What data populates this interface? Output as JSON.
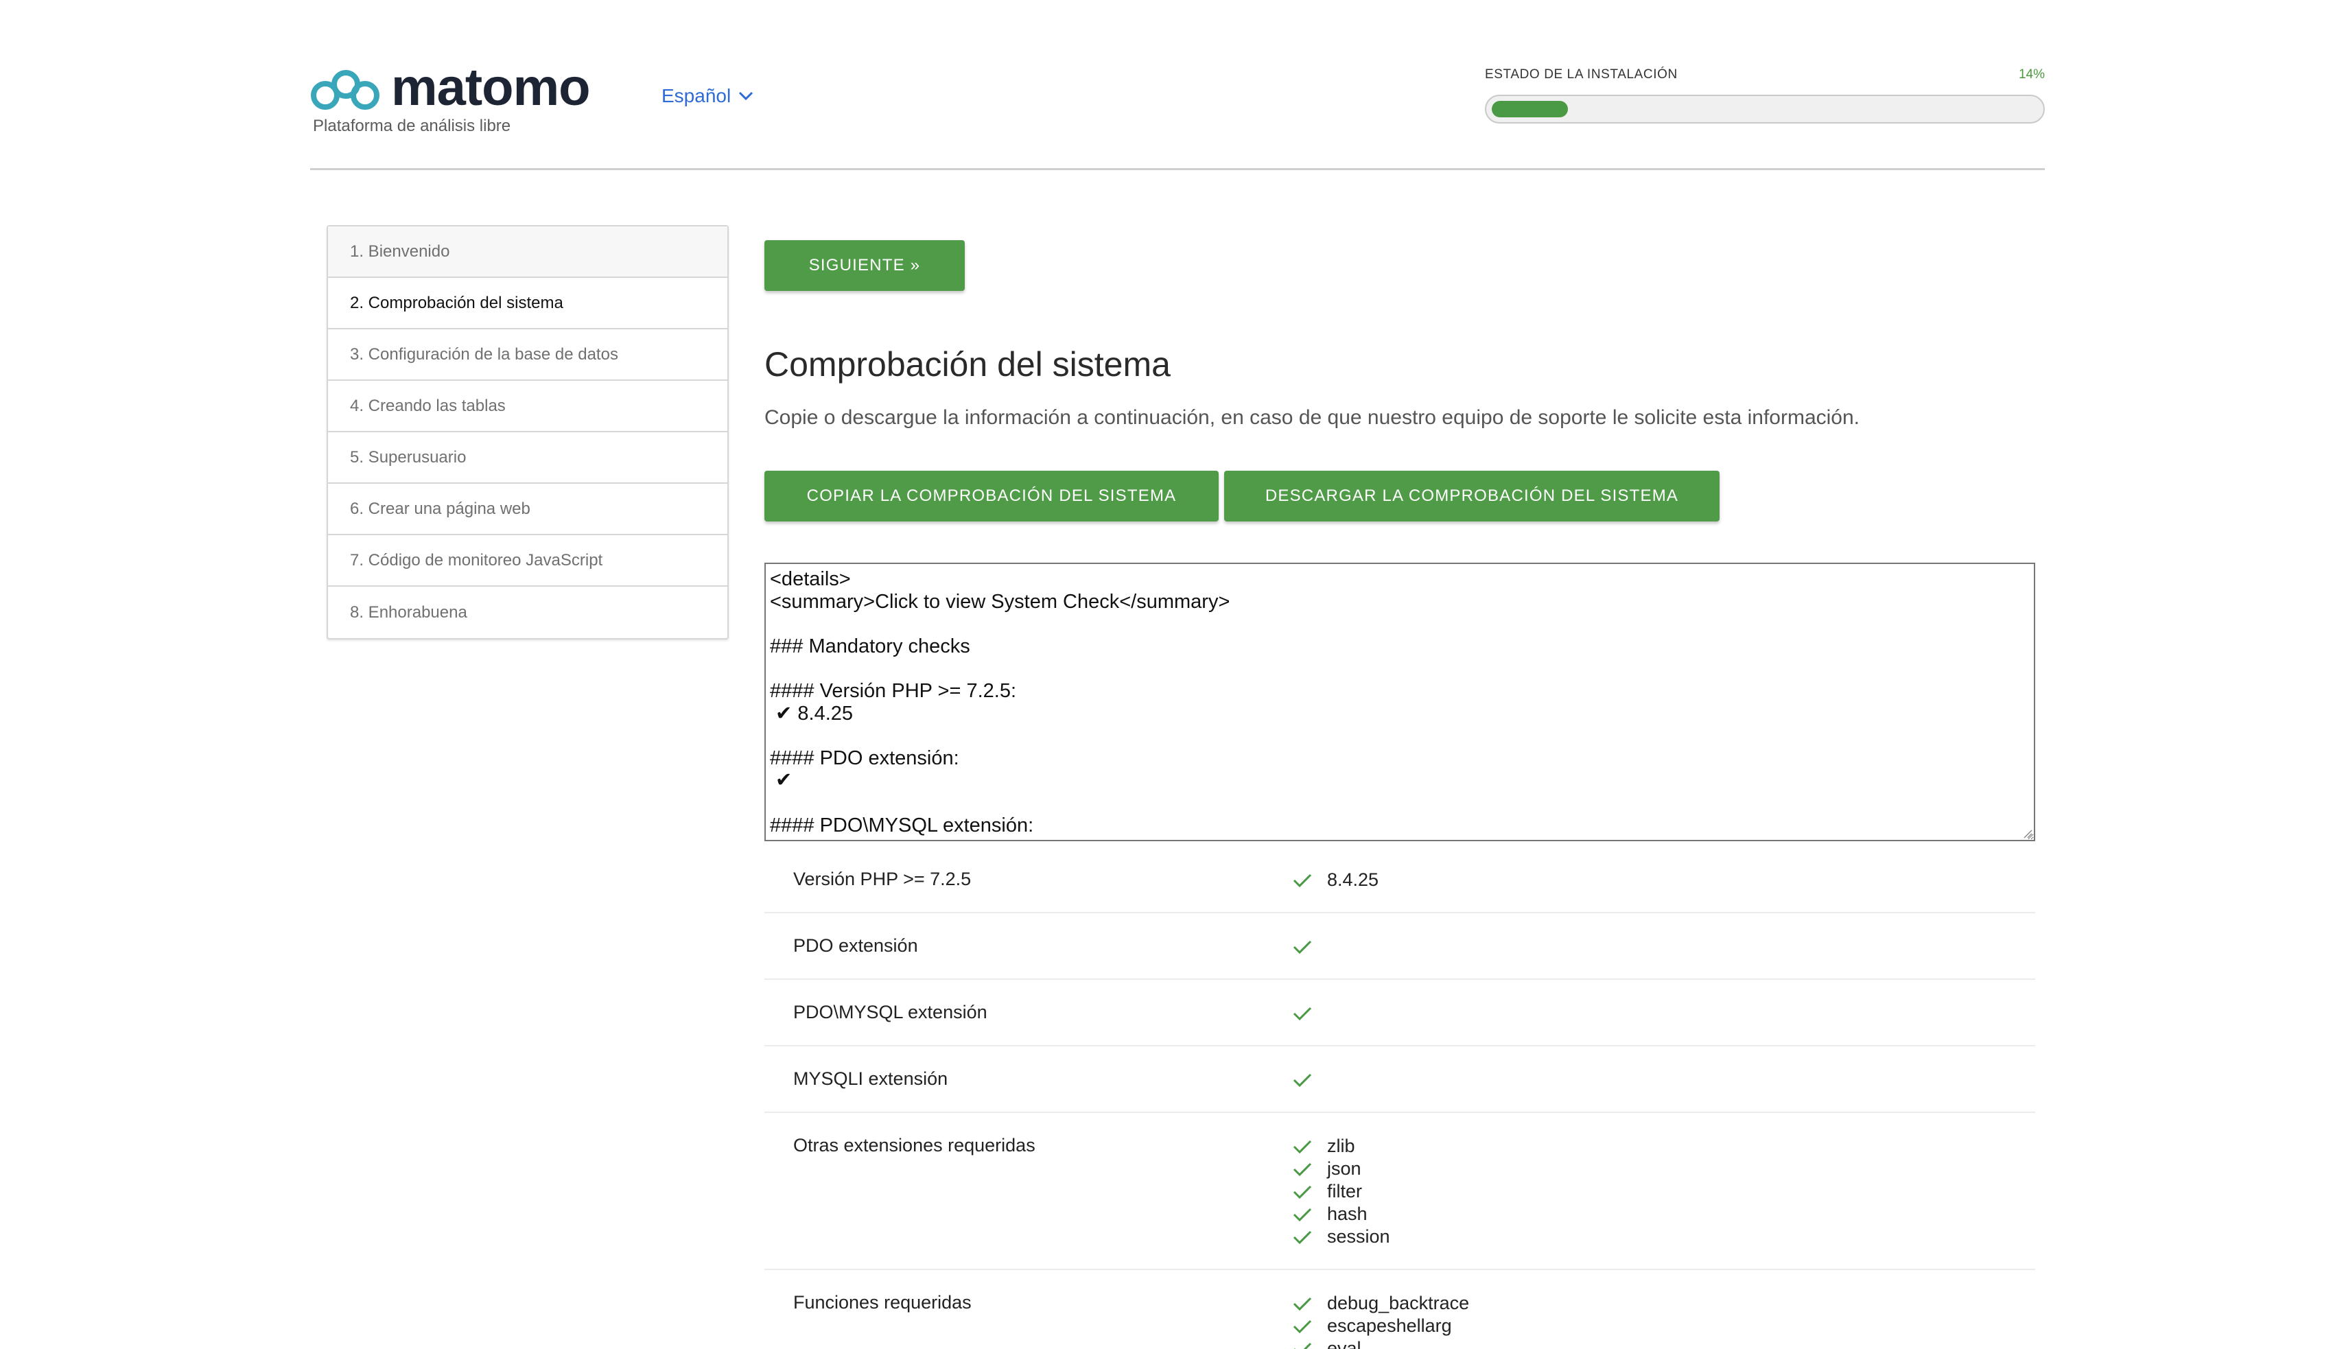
{
  "header": {
    "logo_text": "matomo",
    "tagline": "Plataforma de análisis libre",
    "language": "Español",
    "install_status_label": "ESTADO DE LA INSTALACIÓN",
    "install_progress_text": "14%",
    "install_progress": 0.14,
    "accent_color": "#4f9b48",
    "link_color": "#2f6bd6"
  },
  "steps": [
    {
      "label": "1. Bienvenido",
      "state": "done"
    },
    {
      "label": "2. Comprobación del sistema",
      "state": "active"
    },
    {
      "label": "3. Configuración de la base de datos",
      "state": "pending"
    },
    {
      "label": "4. Creando las tablas",
      "state": "pending"
    },
    {
      "label": "5. Superusuario",
      "state": "pending"
    },
    {
      "label": "6. Crear una página web",
      "state": "pending"
    },
    {
      "label": "7. Código de monitoreo JavaScript",
      "state": "pending"
    },
    {
      "label": "8. Enhorabuena",
      "state": "pending"
    }
  ],
  "main": {
    "next_button": "SIGUIENTE »",
    "title": "Comprobación del sistema",
    "subtitle": "Copie o descargue la información a continuación, en caso de que nuestro equipo de soporte le solicite esta información.",
    "copy_button": "COPIAR LA COMPROBACIÓN DEL SISTEMA",
    "download_button": "DESCARGAR LA COMPROBACIÓN DEL SISTEMA",
    "report_text": "<details>\n<summary>Click to view System Check</summary>\n\n### Mandatory checks\n\n#### Versión PHP >= 7.2.5:\n ✔ 8.4.25\n\n#### PDO extensión:\n ✔\n\n#### PDO\\MYSQL extensión:"
  },
  "checks": [
    {
      "name": "Versión PHP >= 7.2.5",
      "values": [
        "8.4.25"
      ]
    },
    {
      "name": "PDO extensión",
      "values": [
        ""
      ]
    },
    {
      "name": "PDO\\MYSQL extensión",
      "values": [
        ""
      ]
    },
    {
      "name": "MYSQLI extensión",
      "values": [
        ""
      ]
    },
    {
      "name": "Otras extensiones requeridas",
      "values": [
        "zlib",
        "json",
        "filter",
        "hash",
        "session"
      ]
    },
    {
      "name": "Funciones requeridas",
      "values": [
        "debug_backtrace",
        "escapeshellarg",
        "eval"
      ]
    }
  ]
}
